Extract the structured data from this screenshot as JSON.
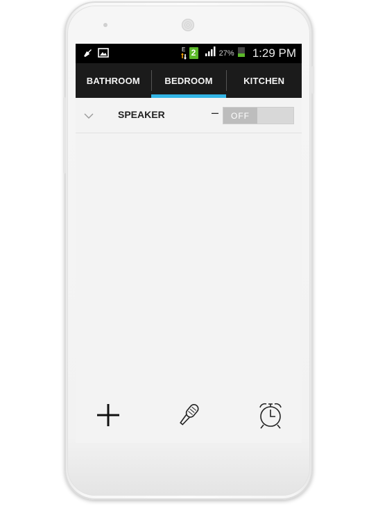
{
  "status_bar": {
    "network_type": "E",
    "sim_badge": "2",
    "battery_percent": "27%",
    "time": "1:29 PM",
    "icons": [
      "cleanup-icon",
      "image-icon",
      "data-arrows-icon",
      "sim-2-icon",
      "signal-icon",
      "battery-icon"
    ]
  },
  "tabs": [
    {
      "label": "BATHROOM",
      "active": false
    },
    {
      "label": "BEDROOM",
      "active": true
    },
    {
      "label": "KITCHEN",
      "active": false
    }
  ],
  "devices": [
    {
      "name": "SPEAKER",
      "dash": "–",
      "state": "OFF"
    }
  ],
  "bottom_actions": [
    {
      "icon": "plus-icon"
    },
    {
      "icon": "microphone-icon"
    },
    {
      "icon": "alarm-clock-icon"
    }
  ],
  "colors": {
    "tab_indicator": "#33b5e5",
    "tab_bar": "#1b1b1b",
    "status_bar": "#000000",
    "screen_background": "#f3f3f3",
    "battery_fill": "#5cb82a"
  }
}
